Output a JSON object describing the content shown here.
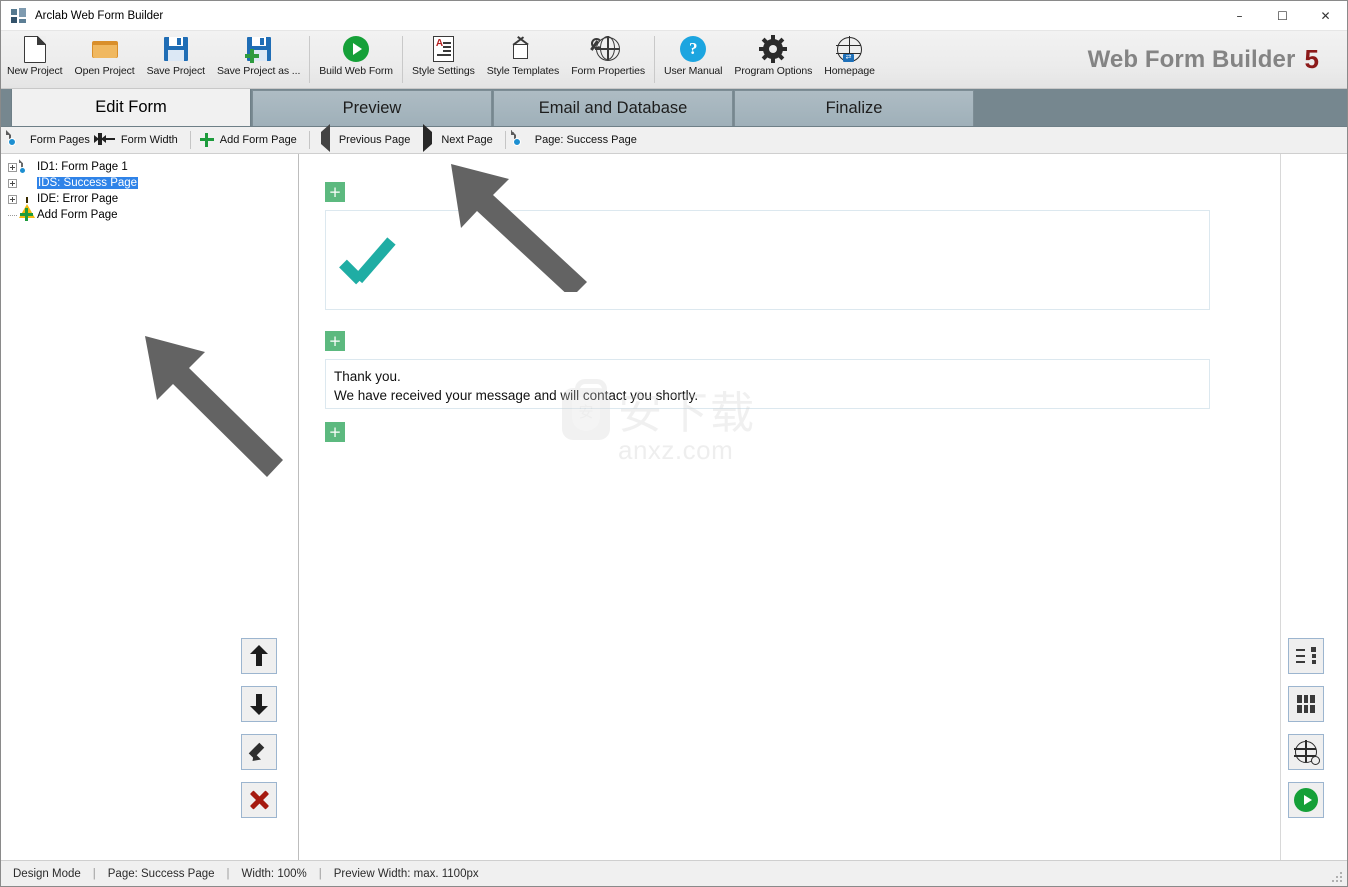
{
  "window": {
    "title": "Arclab Web Form Builder",
    "app_icon": "app-tiles-icon",
    "minimize": "–",
    "maximize": "☐",
    "close": "✕"
  },
  "brand": {
    "name": "Web Form Builder",
    "version": "5",
    "version_color": "#8c1a1a"
  },
  "ribbon": {
    "groups": [
      {
        "items": [
          {
            "label": "New Project",
            "icon": "new-document-icon"
          },
          {
            "label": "Open Project",
            "icon": "open-folder-icon"
          },
          {
            "label": "Save Project",
            "icon": "floppy-disk-icon"
          },
          {
            "label": "Save Project as ...",
            "icon": "floppy-disk-plus-icon"
          }
        ]
      },
      {
        "items": [
          {
            "label": "Build Web Form",
            "icon": "green-play-circle-icon"
          }
        ]
      },
      {
        "items": [
          {
            "label": "Style Settings",
            "icon": "style-document-icon"
          },
          {
            "label": "Style Templates",
            "icon": "template-cube-icon"
          },
          {
            "label": "Form Properties",
            "icon": "wrench-globe-icon"
          }
        ]
      },
      {
        "items": [
          {
            "label": "User Manual",
            "icon": "blue-question-circle-icon"
          },
          {
            "label": "Program Options",
            "icon": "gear-icon"
          },
          {
            "label": "Homepage",
            "icon": "globe-link-icon"
          }
        ]
      }
    ]
  },
  "tabs": [
    {
      "label": "Edit Form",
      "active": true
    },
    {
      "label": "Preview",
      "active": false
    },
    {
      "label": "Email and Database",
      "active": false
    },
    {
      "label": "Finalize",
      "active": false
    }
  ],
  "subtoolbar": [
    {
      "label": "Form Pages",
      "icon": "form-pages-icon"
    },
    {
      "label": "Form Width",
      "icon": "form-width-icon"
    },
    {
      "label": "Add Form Page",
      "icon": "green-plus-icon"
    },
    {
      "label": "Previous Page",
      "icon": "triangle-left-icon"
    },
    {
      "label": "Next Page",
      "icon": "triangle-right-icon"
    },
    {
      "label": "Page: Success Page",
      "icon": "page-icon"
    }
  ],
  "tree": {
    "items": [
      {
        "label": "ID1: Form Page 1",
        "icon": "page-icon",
        "selected": false,
        "expander": true
      },
      {
        "label": "IDS: Success Page",
        "icon": "green-check-circle-icon",
        "selected": true,
        "expander": true
      },
      {
        "label": "IDE: Error Page",
        "icon": "yellow-warning-triangle-icon",
        "selected": false,
        "expander": true
      },
      {
        "label": "Add Form Page",
        "icon": "green-plus-icon",
        "selected": false,
        "expander": false
      }
    ]
  },
  "left_buttons": [
    {
      "name": "move-up-button",
      "icon": "arrow-up-icon"
    },
    {
      "name": "move-down-button",
      "icon": "arrow-down-icon"
    },
    {
      "name": "edit-button",
      "icon": "pencil-icon"
    },
    {
      "name": "delete-button",
      "icon": "red-x-icon"
    }
  ],
  "right_buttons": [
    {
      "name": "form-elements-button",
      "icon": "list-properties-icon"
    },
    {
      "name": "layout-grid-button",
      "icon": "grid-icon"
    },
    {
      "name": "preview-web-button",
      "icon": "globe-search-icon"
    },
    {
      "name": "run-button",
      "icon": "green-play-circle-icon"
    }
  ],
  "canvas": {
    "add_block_label": "+",
    "check_icon_color": "#1fada4",
    "message_line1": "Thank you.",
    "message_line2": "We have received your message and will contact you shortly."
  },
  "watermark": {
    "cn_text": "安下载",
    "badge_char": "安",
    "domain": "anxz.com"
  },
  "statusbar": {
    "mode": "Design Mode",
    "page": "Page: Success Page",
    "width": "Width: 100%",
    "preview_width": "Preview Width: max. 1100px",
    "separator": "|"
  }
}
